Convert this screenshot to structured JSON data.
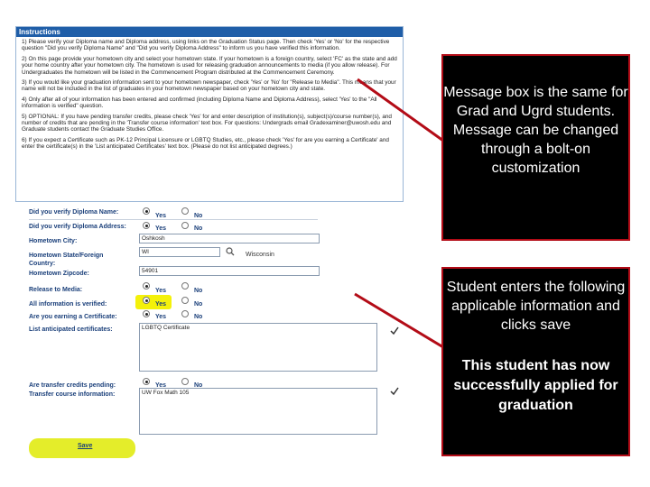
{
  "instructions": {
    "title": "Instructions",
    "paragraphs": [
      "1) Please verify your Diploma name and Diploma address, using links on the Graduation Status page.  Then check 'Yes' or 'No' for the respective question \"Did you verify Diploma Name\" and \"Did you verify Diploma Address\" to inform us you have verified this information.",
      "2) On this page provide your hometown city and select your hometown state.  If your hometown is a foreign country, select 'FC' as the state and add your home country after your hometown city.  The hometown is used for releasing graduation announcements to media (if you allow release). For Undergraduates the hometown will be listed in the Commencement Program distributed at the Commencement Ceremony.",
      "3) If you would like your graduation information sent to your hometown newspaper, check 'Yes' or 'No' for \"Release to Media\". This means that your name will not be included in the list of graduates in your hometown newspaper based on your hometown city and state.",
      "4) Only after all of your information has been entered and confirmed (including Diploma Name and Diploma Address), select 'Yes' to the \"All information is verified\" question.",
      "5) OPTIONAL: If you have pending transfer credits, please check 'Yes' for and enter description of institution(s), subject(s)/course number(s), and number of credits that are pending in the 'Transfer course information' text box. For questions: Undergrads email Gradexaminer@uwosh.edu and Graduate students contact the Graduate Studies Office.",
      "6) If you expect a Certificate such as PK-12 Principal Licensure or LGBTQ Studies, etc., please check 'Yes' for are you earning a Certificate' and enter the certificate(s) in the 'List anticipated Certificates' text box. (Please do not list anticipated degrees.)"
    ]
  },
  "form": {
    "diploma_name_label": "Did you verify Diploma Name:",
    "diploma_address_label": "Did you verify Diploma Address:",
    "hometown_city_label": "Hometown City:",
    "hometown_city_value": "Oshkosh",
    "hometown_state_label": "Hometown State/Foreign Country:",
    "hometown_state_value": "WI",
    "state_name": "Wisconsin",
    "zip_label": "Hometown Zipcode:",
    "zip_value": "54901",
    "release_label": "Release to Media:",
    "verified_label": "All information is verified:",
    "certificate_label": "Are you earning a Certificate:",
    "cert_list_label": "List anticipated certificates:",
    "cert_list_value": "LGBTQ Certificate",
    "transfer_pending_label": "Are transfer credits pending:",
    "transfer_info_label": "Transfer course information:",
    "transfer_info_value": "UW Fox Math 105",
    "yes": "Yes",
    "no": "No",
    "save": "Save"
  },
  "callouts": {
    "top": "Message box is the same for Grad and Ugrd students. Message can be changed through a bolt-on customization",
    "bottom_text": "Student enters the following applicable information and clicks save",
    "bottom_bold": "This student has now successfully applied for graduation"
  }
}
